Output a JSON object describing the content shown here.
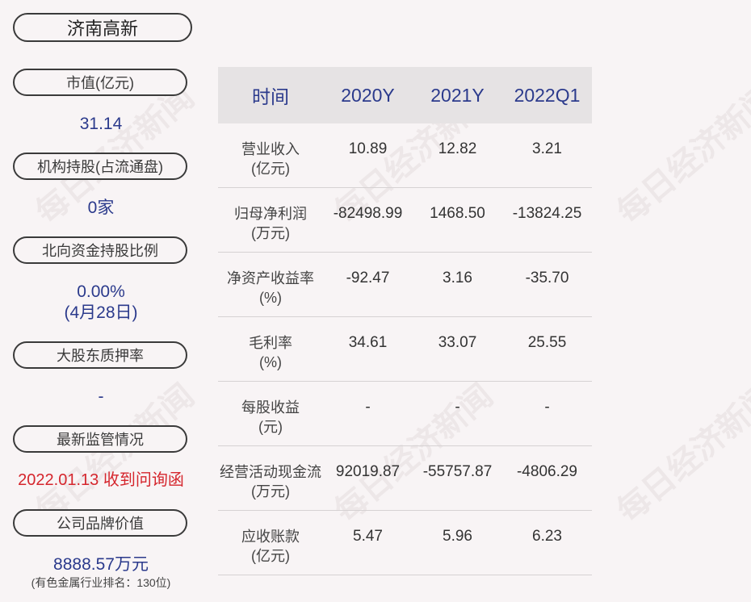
{
  "company": "济南高新",
  "left": {
    "market_cap_label": "市值(亿元)",
    "market_cap_value": "31.14",
    "inst_label": "机构持股(占流通盘)",
    "inst_value": "0家",
    "north_label": "北向资金持股比例",
    "north_value": "0.00%",
    "north_date": "(4月28日)",
    "pledge_label": "大股东质押率",
    "pledge_value": "-",
    "supervision_label": "最新监管情况",
    "supervision_value": "2022.01.13 收到问询函",
    "brand_label": "公司品牌价值",
    "brand_value": "8888.57万元",
    "brand_rank": "(有色金属行业排名：130位)"
  },
  "table": {
    "headers": [
      "时间",
      "2020Y",
      "2021Y",
      "2022Q1"
    ],
    "rows": [
      {
        "label": "营业收入",
        "unit": "(亿元)",
        "values": [
          "10.89",
          "12.82",
          "3.21"
        ]
      },
      {
        "label": "归母净利润",
        "unit": "(万元)",
        "values": [
          "-82498.99",
          "1468.50",
          "-13824.25"
        ]
      },
      {
        "label": "净资产收益率",
        "unit": "(%)",
        "values": [
          "-92.47",
          "3.16",
          "-35.70"
        ]
      },
      {
        "label": "毛利率",
        "unit": "(%)",
        "values": [
          "34.61",
          "33.07",
          "25.55"
        ]
      },
      {
        "label": "每股收益",
        "unit": "(元)",
        "values": [
          "-",
          "-",
          "-"
        ]
      },
      {
        "label": "经营活动现金流",
        "unit": "(万元)",
        "values": [
          "92019.87",
          "-55757.87",
          "-4806.29"
        ]
      },
      {
        "label": "应收账款",
        "unit": "(亿元)",
        "values": [
          "5.47",
          "5.96",
          "6.23"
        ]
      }
    ]
  },
  "watermark": "每日经济新闻"
}
